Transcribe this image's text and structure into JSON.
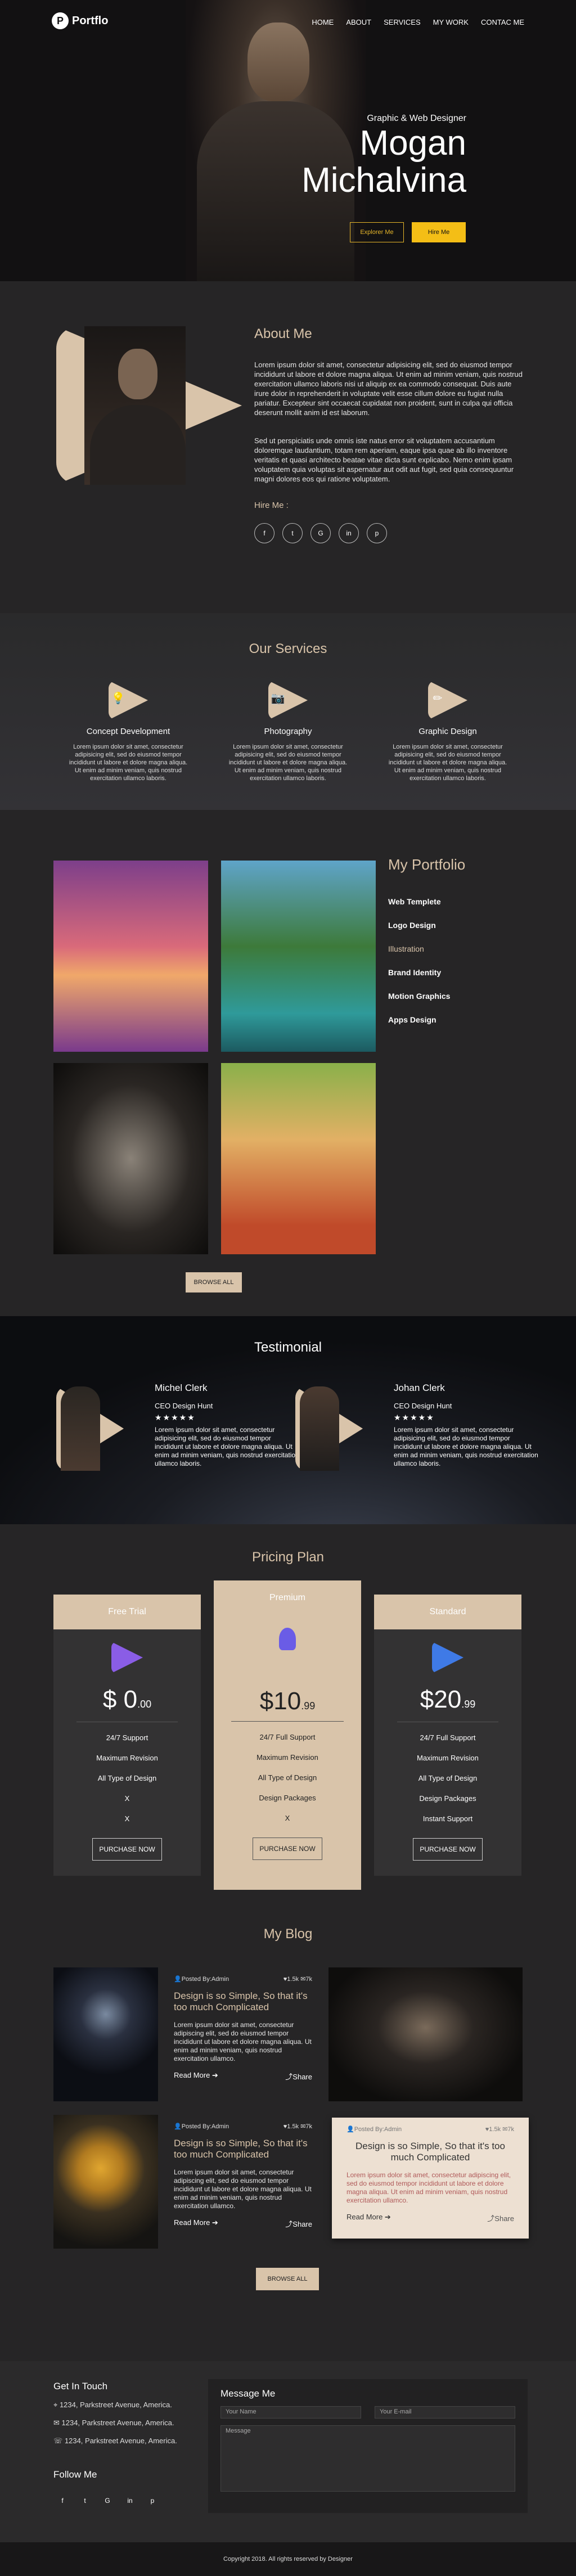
{
  "brand": {
    "name": "Portflo",
    "mark": "P"
  },
  "nav": [
    "HOME",
    "ABOUT",
    "SERVICES",
    "MY WORK",
    "CONTAC ME"
  ],
  "hero": {
    "subtitle": "Graphic & Web Designer",
    "name_line1": "Mogan",
    "name_line2": "Michalvina",
    "btn_explore": "Explorer Me",
    "btn_hire": "Hire Me"
  },
  "about": {
    "title": "About Me",
    "para1": "Lorem ipsum dolor sit amet, consectetur adipisicing elit, sed do eiusmod tempor incididunt ut labore et dolore magna aliqua. Ut enim ad minim veniam, quis nostrud exercitation ullamco laboris nisi ut aliquip ex ea commodo consequat. Duis aute irure dolor in reprehenderit in voluptate velit esse cillum dolore eu fugiat nulla pariatur. Excepteur sint occaecat cupidatat non proident, sunt in culpa qui officia deserunt mollit anim id est laborum.",
    "para2": "Sed ut perspiciatis unde omnis iste natus error sit voluptatem accusantium doloremque laudantium, totam rem aperiam, eaque ipsa quae ab illo inventore veritatis et quasi architecto beatae vitae dicta sunt explicabo. Nemo enim ipsam voluptatem quia voluptas sit aspernatur aut odit aut fugit, sed quia consequuntur magni dolores eos qui ratione voluptatem.",
    "hire_label": "Hire Me :",
    "socials": [
      "f",
      "t",
      "G",
      "in",
      "p"
    ]
  },
  "services": {
    "title": "Our Services",
    "items": [
      {
        "name": "Concept Development",
        "text": "Lorem ipsum dolor sit amet, consectetur adipisicing elit, sed do eiusmod tempor incididunt ut labore et dolore magna aliqua. Ut enim ad minim veniam, quis nostrud exercitation ullamco laboris."
      },
      {
        "name": "Photography",
        "text": "Lorem ipsum dolor sit amet, consectetur adipisicing elit, sed do eiusmod tempor incididunt ut labore et dolore magna aliqua. Ut enim ad minim veniam, quis nostrud exercitation ullamco laboris."
      },
      {
        "name": "Graphic Design",
        "text": "Lorem ipsum dolor sit amet, consectetur adipisicing elit, sed do eiusmod tempor incididunt ut labore et dolore magna aliqua. Ut enim ad minim veniam, quis nostrud exercitation ullamco laboris."
      }
    ]
  },
  "portfolio": {
    "title": "My Portfolio",
    "categories": [
      "Web Templete",
      "Logo Design",
      "Illustration",
      "Brand Identity",
      "Motion Graphics",
      "Apps Design"
    ],
    "browse": "BROWSE ALL"
  },
  "testimonial": {
    "title": "Testimonial",
    "items": [
      {
        "name": "Michel Clerk",
        "role": "CEO Design Hunt",
        "stars": "★★★★★",
        "text": "Lorem ipsum dolor sit amet, consectetur adipisicing elit, sed do eiusmod tempor incididunt ut labore et dolore magna aliqua. Ut enim ad minim veniam, quis nostrud exercitation ullamco laboris."
      },
      {
        "name": "Johan Clerk",
        "role": "CEO Design Hunt",
        "stars": "★★★★★",
        "text": "Lorem ipsum dolor sit amet, consectetur adipisicing elit, sed do eiusmod tempor incididunt ut labore et dolore magna aliqua. Ut enim ad minim veniam, quis nostrud exercitation ullamco laboris."
      }
    ]
  },
  "pricing": {
    "title": "Pricing Plan",
    "plans": [
      {
        "name": "Free Trial",
        "price": "$ 0",
        "cents": ".00",
        "features": [
          "24/7 Support",
          "Maximum Revision",
          "All Type of Design",
          "X",
          "X"
        ],
        "button": "PURCHASE NOW"
      },
      {
        "name": "Premium",
        "price": "$10",
        "cents": ".99",
        "features": [
          "24/7 Full Support",
          "Maximum Revision",
          "All Type of Design",
          "Design Packages",
          "X"
        ],
        "button": "PURCHASE NOW"
      },
      {
        "name": "Standard",
        "price": "$20",
        "cents": ".99",
        "features": [
          "24/7 Full Support",
          "Maximum Revision",
          "All Type of Design",
          "Design Packages",
          "Instant Support"
        ],
        "button": "PURCHASE NOW"
      }
    ]
  },
  "blog": {
    "title": "My Blog",
    "post": {
      "author": "Posted By:Admin",
      "likes": "1.5k",
      "comments": "7k",
      "title": "Design is so Simple, So that it's too much Complicated",
      "text": "Lorem ipsum dolor sit amet, consectetur adipiscing elit, sed do eiusmod tempor incididunt ut labore et dolore magna aliqua. Ut enim ad minim veniam, quis nostrud exercitation ullamco.",
      "read_more": "Read More",
      "share": "Share"
    },
    "browse": "BROWSE ALL"
  },
  "contact": {
    "get_in_touch": "Get In Touch",
    "lines": [
      "1234, Parkstreet Avenue, America.",
      "1234, Parkstreet Avenue, America.",
      "1234, Parkstreet Avenue, America."
    ],
    "follow_me": "Follow Me",
    "message_title": "Message Me",
    "name_placeholder": "Your Name",
    "email_placeholder": "Your E-mail",
    "message_placeholder": "Message"
  },
  "footer": {
    "copyright": "Copyright 2018. All rights reserved by Designer"
  },
  "colors": {
    "accent": "#d9c4aa",
    "yellow": "#f4be16",
    "dark": "#262526"
  }
}
